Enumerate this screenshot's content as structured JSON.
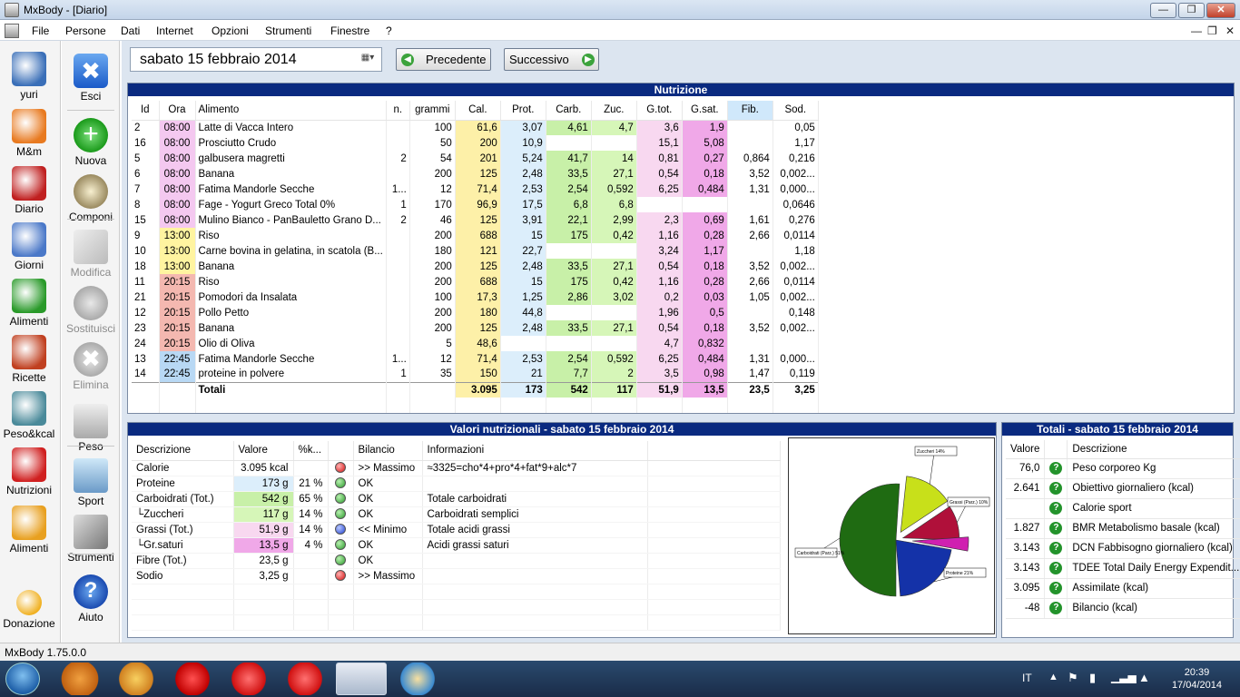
{
  "window": {
    "title": "MxBody - [Diario]"
  },
  "menu": [
    "File",
    "Persone",
    "Dati",
    "Internet",
    "Opzioni",
    "Strumenti",
    "Finestre",
    "?"
  ],
  "left_sidebar": [
    {
      "label": "yuri",
      "icon": "user-avatar-icon"
    },
    {
      "label": "M&m",
      "icon": "pie-chart-icon"
    },
    {
      "label": "Diario",
      "icon": "calendar-icon"
    },
    {
      "label": "Giorni",
      "icon": "calendar-grid-icon"
    },
    {
      "label": "Alimenti",
      "icon": "vegetables-icon"
    },
    {
      "label": "Ricette",
      "icon": "dish-icon"
    },
    {
      "label": "Peso&kcal",
      "icon": "scale-chart-icon"
    },
    {
      "label": "Nutrizioni",
      "icon": "nutrition-chart-icon"
    },
    {
      "label": "Alimenti",
      "icon": "food-pyramid-icon"
    },
    {
      "label": "Donazione",
      "icon": "donation-icon"
    }
  ],
  "toolbar": [
    {
      "label": "Esci",
      "icon": "exit-icon",
      "enabled": true
    },
    {
      "label": "Nuova",
      "icon": "add-icon",
      "enabled": true
    },
    {
      "label": "Componi",
      "icon": "salad-icon",
      "enabled": true
    },
    {
      "label": "Modifica",
      "icon": "edit-icon",
      "enabled": false
    },
    {
      "label": "Sostituisci",
      "icon": "replace-icon",
      "enabled": false
    },
    {
      "label": "Elimina",
      "icon": "delete-icon",
      "enabled": false
    },
    {
      "label": "Peso",
      "icon": "scale-icon",
      "enabled": true
    },
    {
      "label": "Sport",
      "icon": "runner-icon",
      "enabled": true
    },
    {
      "label": "Strumenti",
      "icon": "tools-icon",
      "enabled": true
    },
    {
      "label": "Aiuto",
      "icon": "help-icon",
      "enabled": true
    }
  ],
  "date": {
    "value": "sabato   15  febbraio  2014",
    "prev_label": "Precedente",
    "next_label": "Successivo"
  },
  "nutrition": {
    "title": "Nutrizione",
    "headers": [
      "Id",
      "Ora",
      "Alimento",
      "n.",
      "grammi",
      "Cal.",
      "Prot.",
      "Carb.",
      "Zuc.",
      "G.tot.",
      "G.sat.",
      "Fib.",
      "Sod."
    ],
    "rows": [
      {
        "id": "2",
        "time": "08:00",
        "food": "Latte di Vacca Intero",
        "n": "",
        "grams": "100",
        "cal": "61,6",
        "prot": "3,07",
        "carb": "4,61",
        "zuc": "4,7",
        "gtot": "3,6",
        "gsat": "1,9",
        "fib": "",
        "sod": "0,05"
      },
      {
        "id": "16",
        "time": "08:00",
        "food": "Prosciutto Crudo",
        "n": "",
        "grams": "50",
        "cal": "200",
        "prot": "10,9",
        "carb": "",
        "zuc": "",
        "gtot": "15,1",
        "gsat": "5,08",
        "fib": "",
        "sod": "1,17"
      },
      {
        "id": "5",
        "time": "08:00",
        "food": "galbusera magretti",
        "n": "2",
        "grams": "54",
        "cal": "201",
        "prot": "5,24",
        "carb": "41,7",
        "zuc": "14",
        "gtot": "0,81",
        "gsat": "0,27",
        "fib": "0,864",
        "sod": "0,216"
      },
      {
        "id": "6",
        "time": "08:00",
        "food": "Banana",
        "n": "",
        "grams": "200",
        "cal": "125",
        "prot": "2,48",
        "carb": "33,5",
        "zuc": "27,1",
        "gtot": "0,54",
        "gsat": "0,18",
        "fib": "3,52",
        "sod": "0,002..."
      },
      {
        "id": "7",
        "time": "08:00",
        "food": "Fatima Mandorle Secche",
        "n": "1...",
        "grams": "12",
        "cal": "71,4",
        "prot": "2,53",
        "carb": "2,54",
        "zuc": "0,592",
        "gtot": "6,25",
        "gsat": "0,484",
        "fib": "1,31",
        "sod": "0,000..."
      },
      {
        "id": "8",
        "time": "08:00",
        "food": "Fage - Yogurt Greco Total 0%",
        "n": "1",
        "grams": "170",
        "cal": "96,9",
        "prot": "17,5",
        "carb": "6,8",
        "zuc": "6,8",
        "gtot": "",
        "gsat": "",
        "fib": "",
        "sod": "0,0646"
      },
      {
        "id": "15",
        "time": "08:00",
        "food": "Mulino Bianco - PanBauletto Grano D...",
        "n": "2",
        "grams": "46",
        "cal": "125",
        "prot": "3,91",
        "carb": "22,1",
        "zuc": "2,99",
        "gtot": "2,3",
        "gsat": "0,69",
        "fib": "1,61",
        "sod": "0,276"
      },
      {
        "id": "9",
        "time": "13:00",
        "food": "Riso",
        "n": "",
        "grams": "200",
        "cal": "688",
        "prot": "15",
        "carb": "175",
        "zuc": "0,42",
        "gtot": "1,16",
        "gsat": "0,28",
        "fib": "2,66",
        "sod": "0,0114"
      },
      {
        "id": "10",
        "time": "13:00",
        "food": "Carne bovina in gelatina, in scatola (B...",
        "n": "",
        "grams": "180",
        "cal": "121",
        "prot": "22,7",
        "carb": "",
        "zuc": "",
        "gtot": "3,24",
        "gsat": "1,17",
        "fib": "",
        "sod": "1,18"
      },
      {
        "id": "18",
        "time": "13:00",
        "food": "Banana",
        "n": "",
        "grams": "200",
        "cal": "125",
        "prot": "2,48",
        "carb": "33,5",
        "zuc": "27,1",
        "gtot": "0,54",
        "gsat": "0,18",
        "fib": "3,52",
        "sod": "0,002..."
      },
      {
        "id": "11",
        "time": "20:15",
        "food": "Riso",
        "n": "",
        "grams": "200",
        "cal": "688",
        "prot": "15",
        "carb": "175",
        "zuc": "0,42",
        "gtot": "1,16",
        "gsat": "0,28",
        "fib": "2,66",
        "sod": "0,0114"
      },
      {
        "id": "21",
        "time": "20:15",
        "food": "Pomodori da Insalata",
        "n": "",
        "grams": "100",
        "cal": "17,3",
        "prot": "1,25",
        "carb": "2,86",
        "zuc": "3,02",
        "gtot": "0,2",
        "gsat": "0,03",
        "fib": "1,05",
        "sod": "0,002..."
      },
      {
        "id": "12",
        "time": "20:15",
        "food": "Pollo Petto",
        "n": "",
        "grams": "200",
        "cal": "180",
        "prot": "44,8",
        "carb": "",
        "zuc": "",
        "gtot": "1,96",
        "gsat": "0,5",
        "fib": "",
        "sod": "0,148"
      },
      {
        "id": "23",
        "time": "20:15",
        "food": "Banana",
        "n": "",
        "grams": "200",
        "cal": "125",
        "prot": "2,48",
        "carb": "33,5",
        "zuc": "27,1",
        "gtot": "0,54",
        "gsat": "0,18",
        "fib": "3,52",
        "sod": "0,002..."
      },
      {
        "id": "24",
        "time": "20:15",
        "food": "Olio di Oliva",
        "n": "",
        "grams": "5",
        "cal": "48,6",
        "prot": "",
        "carb": "",
        "zuc": "",
        "gtot": "4,7",
        "gsat": "0,832",
        "fib": "",
        "sod": ""
      },
      {
        "id": "13",
        "time": "22:45",
        "food": "Fatima Mandorle Secche",
        "n": "1...",
        "grams": "12",
        "cal": "71,4",
        "prot": "2,53",
        "carb": "2,54",
        "zuc": "0,592",
        "gtot": "6,25",
        "gsat": "0,484",
        "fib": "1,31",
        "sod": "0,000..."
      },
      {
        "id": "14",
        "time": "22:45",
        "food": "proteine in polvere",
        "n": "1",
        "grams": "35",
        "cal": "150",
        "prot": "21",
        "carb": "7,7",
        "zuc": "2",
        "gtot": "3,5",
        "gsat": "0,98",
        "fib": "1,47",
        "sod": "0,119"
      }
    ],
    "totals": {
      "label": "Totali",
      "cal": "3.095",
      "prot": "173",
      "carb": "542",
      "zuc": "117",
      "gtot": "51,9",
      "gsat": "13,5",
      "fib": "23,5",
      "sod": "3,25"
    }
  },
  "values_panel": {
    "title": "Valori nutrizionali - sabato 15 febbraio 2014",
    "headers": [
      "Descrizione",
      "Valore",
      "%k...",
      "",
      "Bilancio",
      "Informazioni"
    ],
    "rows": [
      {
        "desc": "Calorie",
        "value": "3.095 kcal",
        "pct": "",
        "status": "red",
        "balance": ">> Massimo",
        "info": "≈3325=cho*4+pro*4+fat*9+alc*7"
      },
      {
        "desc": "Proteine",
        "value": "173 g",
        "pct": "21 %",
        "status": "green",
        "balance": "OK",
        "info": ""
      },
      {
        "desc": "Carboidrati (Tot.)",
        "value": "542 g",
        "pct": "65 %",
        "status": "green",
        "balance": "OK",
        "info": "Totale carboidrati"
      },
      {
        "desc": "└Zuccheri",
        "value": "117 g",
        "pct": "14 %",
        "status": "green",
        "balance": "OK",
        "info": "Carboidrati semplici"
      },
      {
        "desc": "Grassi (Tot.)",
        "value": "51,9 g",
        "pct": "14 %",
        "status": "blue",
        "balance": "<< Minimo",
        "info": "Totale acidi grassi"
      },
      {
        "desc": "└Gr.saturi",
        "value": "13,5 g",
        "pct": "4 %",
        "status": "green",
        "balance": "OK",
        "info": "Acidi grassi saturi"
      },
      {
        "desc": "Fibre (Tot.)",
        "value": "23,5 g",
        "pct": "",
        "status": "green",
        "balance": "OK",
        "info": ""
      },
      {
        "desc": "Sodio",
        "value": "3,25 g",
        "pct": "",
        "status": "red",
        "balance": ">> Massimo",
        "info": ""
      }
    ]
  },
  "pie": {
    "slices": [
      {
        "label": "Carboidrati (Parz.) 51%",
        "value": 51,
        "color": "#1f6b12"
      },
      {
        "label": "Zuccheri 14%",
        "value": 14,
        "color": "#c8e01a"
      },
      {
        "label": "Grassi (Parz.) 10%",
        "value": 10,
        "color": "#b0103a"
      },
      {
        "label": "",
        "value": 4,
        "color": "#d020b0"
      },
      {
        "label": "Proteine 21%",
        "value": 21,
        "color": "#1432a8"
      }
    ]
  },
  "totals_panel": {
    "title": "Totali - sabato 15 febbraio 2014",
    "headers": [
      "Valore",
      "Descrizione"
    ],
    "rows": [
      {
        "value": "76,0",
        "desc": "Peso corporeo Kg"
      },
      {
        "value": "2.641",
        "desc": "Obiettivo giornaliero (kcal)"
      },
      {
        "value": "",
        "desc": "Calorie sport"
      },
      {
        "value": "1.827",
        "desc": "BMR Metabolismo basale (kcal)"
      },
      {
        "value": "3.143",
        "desc": "DCN Fabbisogno giornaliero (kcal)"
      },
      {
        "value": "3.143",
        "desc": "TDEE Total Daily Energy Expendit..."
      },
      {
        "value": "3.095",
        "desc": "Assimilate (kcal)"
      },
      {
        "value": "-48",
        "desc": "Bilancio (kcal)"
      }
    ]
  },
  "status": {
    "version": "MxBody 1.75.0.0"
  },
  "taskbar": {
    "lang": "IT",
    "time": "20:39",
    "date": "17/04/2014"
  }
}
